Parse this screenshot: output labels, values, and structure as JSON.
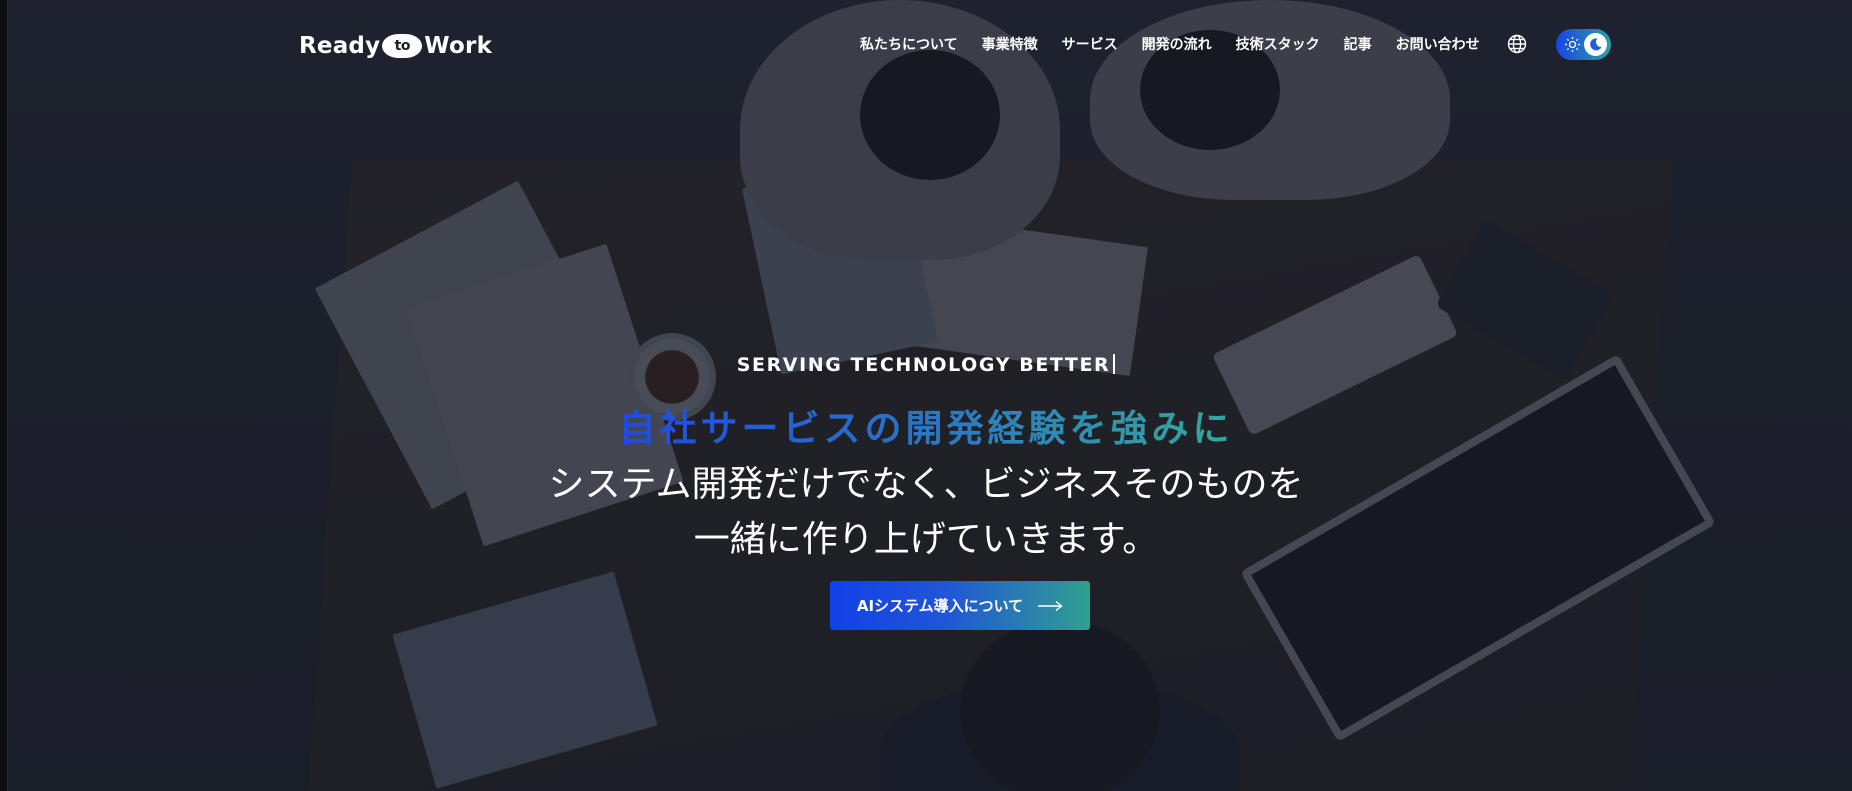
{
  "header": {
    "logo": {
      "left": "Ready",
      "middle": "to",
      "right": "Work"
    },
    "nav": [
      {
        "label": "私たちについて"
      },
      {
        "label": "事業特徴"
      },
      {
        "label": "サービス"
      },
      {
        "label": "開発の流れ"
      },
      {
        "label": "技術スタック"
      },
      {
        "label": "記事"
      },
      {
        "label": "お問い合わせ"
      }
    ],
    "icons": {
      "language": "globe-icon",
      "theme_toggle": "theme-toggle",
      "sun": "sun-icon",
      "moon": "moon-icon"
    }
  },
  "hero": {
    "eyebrow": "SERVING TECHNOLOGY BETTER",
    "heading": "自社サービスの開発経験を強みに",
    "subcopy_line1": "システム開発だけでなく、ビジネスそのものを",
    "subcopy_line2": "一緒に作り上げていきます。",
    "cta_label": "AIシステム導入について",
    "cta_icon": "arrow-right-icon"
  },
  "colors": {
    "overlay": "#161926",
    "gradient_start": "#1d4ae8",
    "gradient_end": "#33a99a",
    "text": "#ffffff"
  }
}
